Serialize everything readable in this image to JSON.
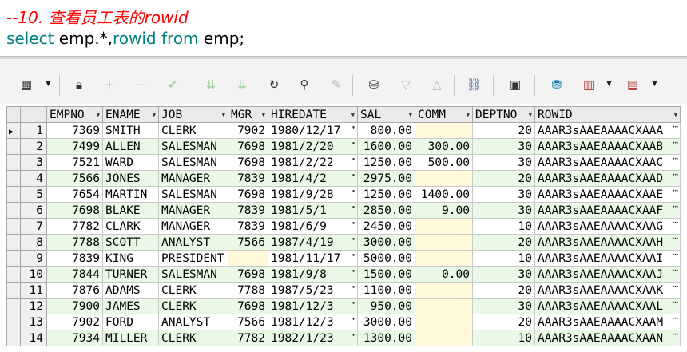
{
  "editor": {
    "comment": "--10. 查看员工表的rowid",
    "sql_kw1": "select",
    "sql_mid": " emp.*,",
    "sql_kw2": "rowid",
    "sql_kw3": " from",
    "sql_end": " emp;"
  },
  "toolbar": {
    "icons": [
      "grid-view-icon",
      "lock-icon",
      "add-icon",
      "remove-icon",
      "check-icon",
      "sort-desc-icon",
      "sort-asc-icon",
      "refresh-icon",
      "find-icon",
      "eraser-icon",
      "query-icon",
      "filter-down-icon",
      "filter-up-icon",
      "link-icon",
      "save-icon",
      "export-icon",
      "chart-icon",
      "table-export-icon"
    ]
  },
  "grid": {
    "columns": [
      "EMPNO",
      "ENAME",
      "JOB",
      "MGR",
      "HIREDATE",
      "SAL",
      "COMM",
      "DEPTNO",
      "ROWID"
    ],
    "rows": [
      {
        "n": "1",
        "empno": "7369",
        "ename": "SMITH",
        "job": "CLERK",
        "mgr": "7902",
        "hiredate": "1980/12/17",
        "sal": "800.00",
        "comm": "",
        "deptno": "20",
        "rowid": "AAAR3sAAEAAAACXAAA"
      },
      {
        "n": "2",
        "empno": "7499",
        "ename": "ALLEN",
        "job": "SALESMAN",
        "mgr": "7698",
        "hiredate": "1981/2/20",
        "sal": "1600.00",
        "comm": "300.00",
        "deptno": "30",
        "rowid": "AAAR3sAAEAAAACXAAB"
      },
      {
        "n": "3",
        "empno": "7521",
        "ename": "WARD",
        "job": "SALESMAN",
        "mgr": "7698",
        "hiredate": "1981/2/22",
        "sal": "1250.00",
        "comm": "500.00",
        "deptno": "30",
        "rowid": "AAAR3sAAEAAAACXAAC"
      },
      {
        "n": "4",
        "empno": "7566",
        "ename": "JONES",
        "job": "MANAGER",
        "mgr": "7839",
        "hiredate": "1981/4/2",
        "sal": "2975.00",
        "comm": "",
        "deptno": "20",
        "rowid": "AAAR3sAAEAAAACXAAD"
      },
      {
        "n": "5",
        "empno": "7654",
        "ename": "MARTIN",
        "job": "SALESMAN",
        "mgr": "7698",
        "hiredate": "1981/9/28",
        "sal": "1250.00",
        "comm": "1400.00",
        "deptno": "30",
        "rowid": "AAAR3sAAEAAAACXAAE"
      },
      {
        "n": "6",
        "empno": "7698",
        "ename": "BLAKE",
        "job": "MANAGER",
        "mgr": "7839",
        "hiredate": "1981/5/1",
        "sal": "2850.00",
        "comm": "9.00",
        "deptno": "30",
        "rowid": "AAAR3sAAEAAAACXAAF"
      },
      {
        "n": "7",
        "empno": "7782",
        "ename": "CLARK",
        "job": "MANAGER",
        "mgr": "7839",
        "hiredate": "1981/6/9",
        "sal": "2450.00",
        "comm": "",
        "deptno": "10",
        "rowid": "AAAR3sAAEAAAACXAAG"
      },
      {
        "n": "8",
        "empno": "7788",
        "ename": "SCOTT",
        "job": "ANALYST",
        "mgr": "7566",
        "hiredate": "1987/4/19",
        "sal": "3000.00",
        "comm": "",
        "deptno": "20",
        "rowid": "AAAR3sAAEAAAACXAAH"
      },
      {
        "n": "9",
        "empno": "7839",
        "ename": "KING",
        "job": "PRESIDENT",
        "mgr": "",
        "hiredate": "1981/11/17",
        "sal": "5000.00",
        "comm": "",
        "deptno": "10",
        "rowid": "AAAR3sAAEAAAACXAAI"
      },
      {
        "n": "10",
        "empno": "7844",
        "ename": "TURNER",
        "job": "SALESMAN",
        "mgr": "7698",
        "hiredate": "1981/9/8",
        "sal": "1500.00",
        "comm": "0.00",
        "deptno": "30",
        "rowid": "AAAR3sAAEAAAACXAAJ"
      },
      {
        "n": "11",
        "empno": "7876",
        "ename": "ADAMS",
        "job": "CLERK",
        "mgr": "7788",
        "hiredate": "1987/5/23",
        "sal": "1100.00",
        "comm": "",
        "deptno": "20",
        "rowid": "AAAR3sAAEAAAACXAAK"
      },
      {
        "n": "12",
        "empno": "7900",
        "ename": "JAMES",
        "job": "CLERK",
        "mgr": "7698",
        "hiredate": "1981/12/3",
        "sal": "950.00",
        "comm": "",
        "deptno": "30",
        "rowid": "AAAR3sAAEAAAACXAAL"
      },
      {
        "n": "13",
        "empno": "7902",
        "ename": "FORD",
        "job": "ANALYST",
        "mgr": "7566",
        "hiredate": "1981/12/3",
        "sal": "3000.00",
        "comm": "",
        "deptno": "20",
        "rowid": "AAAR3sAAEAAAACXAAM"
      },
      {
        "n": "14",
        "empno": "7934",
        "ename": "MILLER",
        "job": "CLERK",
        "mgr": "7782",
        "hiredate": "1982/1/23",
        "sal": "1300.00",
        "comm": "",
        "deptno": "10",
        "rowid": "AAAR3sAAEAAAACXAAN"
      }
    ]
  }
}
